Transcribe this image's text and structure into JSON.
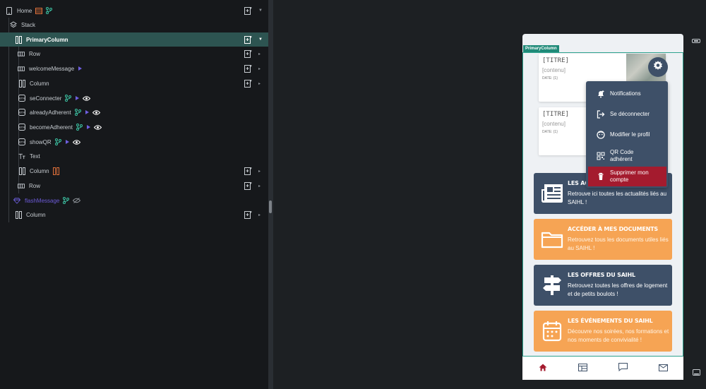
{
  "tree": {
    "items": [
      {
        "label": "Home"
      },
      {
        "label": "Stack"
      },
      {
        "label": "PrimaryColumn"
      },
      {
        "label": "Row"
      },
      {
        "label": "welcomeMessage"
      },
      {
        "label": "Column"
      },
      {
        "label": "seConnecter"
      },
      {
        "label": "alreadyAdherent"
      },
      {
        "label": "becomeAdherent"
      },
      {
        "label": "showQR"
      },
      {
        "label": "Text"
      },
      {
        "label": "Column"
      },
      {
        "label": "Row"
      },
      {
        "label": "flashMessage"
      },
      {
        "label": "Column"
      }
    ]
  },
  "canvas": {
    "selection_tag": "PrimaryColumn",
    "news": [
      {
        "title": "[TITRE]",
        "content": "[contenu]",
        "date": "DATE: {1}"
      },
      {
        "title": "[TITRE]",
        "content": "[contenu]",
        "date": "DATE: {1}"
      }
    ],
    "menu": {
      "items": [
        {
          "label": "Notifications",
          "icon": "bell-plus-icon"
        },
        {
          "label": "Se déconnecter",
          "icon": "logout-icon"
        },
        {
          "label": "Modifier le profil",
          "icon": "face-icon"
        },
        {
          "label_line1": "QR Code",
          "label_line2": "adhérent",
          "icon": "qr-code-icon"
        },
        {
          "label_line1": "Supprimer mon",
          "label_line2": "compte",
          "icon": "trash-icon"
        }
      ]
    },
    "tiles": [
      {
        "title": "LES ACT",
        "desc": "Retrouve ici toutes les actualités liés au SAIHL !",
        "icon": "newspaper-icon"
      },
      {
        "title": "ACCÉDER À MES DOCUMENTS",
        "desc": "Retrouvez tous les documents utiles liés au SAIHL !",
        "icon": "folder-icon"
      },
      {
        "title": "LES OFFRES DU SAIHL",
        "desc": "Retrouvez toutes les offres de logement et de petits boulots !",
        "icon": "signpost-icon"
      },
      {
        "title": "LES ÉVÉNEMENTS DU SAIHL",
        "desc": "Découvre nos soirées, nos formations et nos moments de convivialité !",
        "icon": "calendar-icon"
      }
    ],
    "bottom_nav": [
      "home-icon",
      "dashboard-icon",
      "chat-icon",
      "mail-icon"
    ]
  },
  "colors": {
    "accent_teal": "#2d5451",
    "tile_dark": "#3e5068",
    "tile_orange": "#f6a454",
    "danger": "#a41b2e",
    "nav_active": "#a41b2e"
  }
}
